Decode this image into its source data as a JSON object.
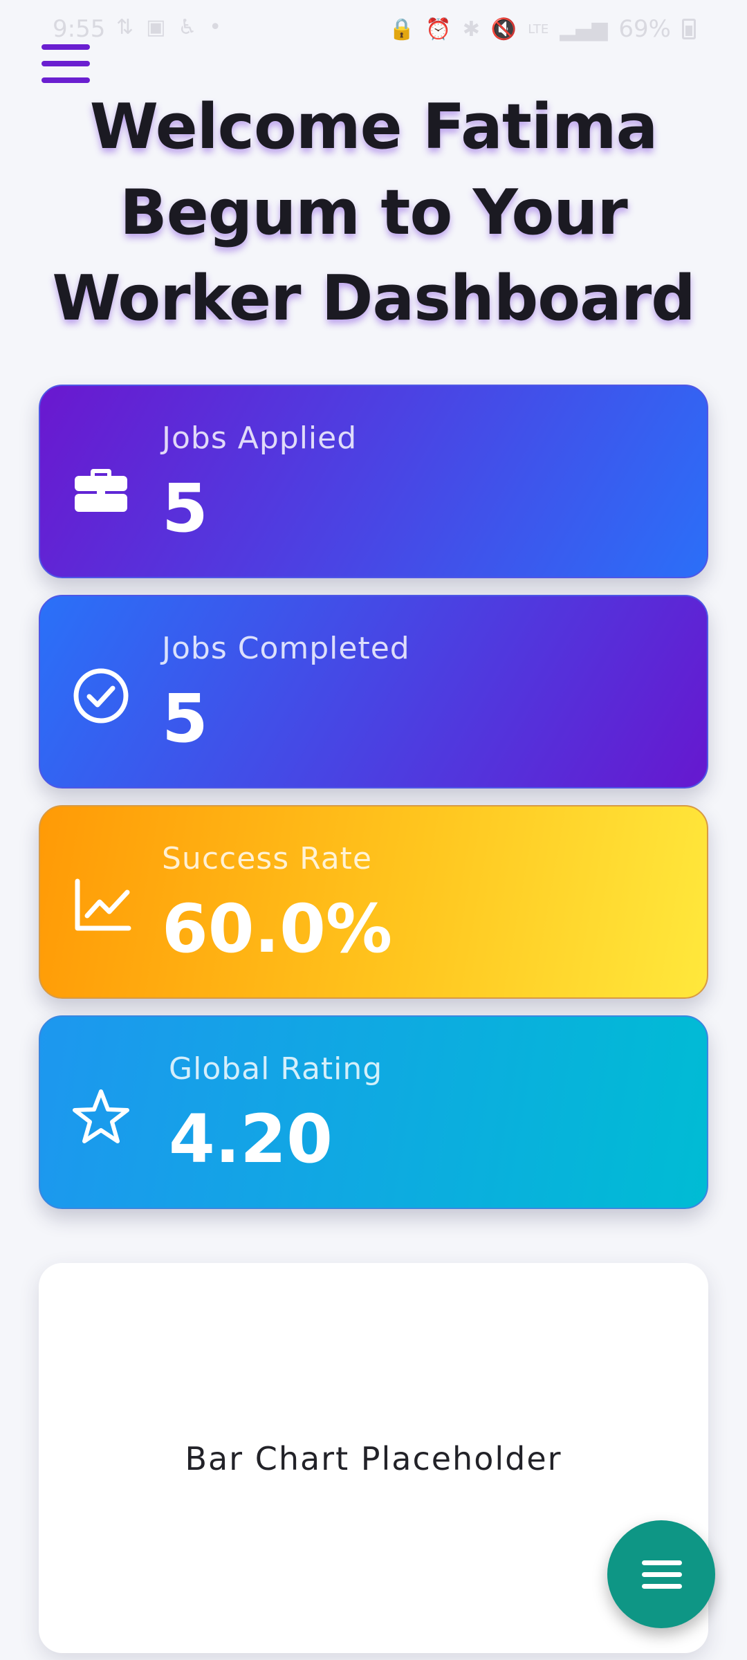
{
  "status_bar": {
    "time": "9:55",
    "battery_percent": "69%",
    "icons": [
      "data-speed-icon",
      "gallery-icon",
      "accessibility-icon",
      "dot-icon",
      "lock-icon",
      "alarm-icon",
      "bluetooth-icon",
      "mute-icon",
      "lte-icon",
      "signal-icon",
      "battery-icon"
    ]
  },
  "header": {
    "menu_icon": "hamburger-menu-icon",
    "title": "Welcome Fatima Begum to Your Worker Dashboard",
    "accent_color": "#6a1fd0"
  },
  "stats": [
    {
      "label": "Jobs Applied",
      "value": "5",
      "icon": "briefcase-icon",
      "gradient": [
        "#6a18cf",
        "#2b6ff8"
      ]
    },
    {
      "label": "Jobs Completed",
      "value": "5",
      "icon": "check-circle-icon",
      "gradient": [
        "#2a71f8",
        "#6618cf"
      ]
    },
    {
      "label": "Success Rate",
      "value": "60.0%",
      "icon": "trending-chart-icon",
      "gradient": [
        "#ff9a06",
        "#ffe83c"
      ]
    },
    {
      "label": "Global Rating",
      "value": "4.20",
      "icon": "star-icon",
      "gradient": [
        "#1d97ef",
        "#00bcd4"
      ]
    }
  ],
  "chart_card": {
    "placeholder_text": "Bar Chart Placeholder"
  },
  "fab": {
    "icon": "menu-icon",
    "color": "#0e9685"
  }
}
